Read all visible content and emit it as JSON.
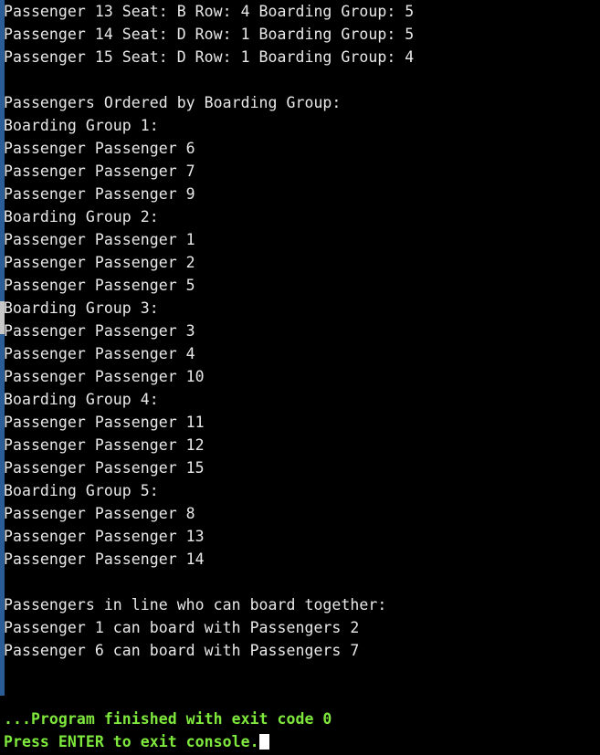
{
  "console": {
    "background_color": "#000000",
    "text_color": "#e9e9e9",
    "exit_text_color": "#7ee83c",
    "scrollbar": {
      "track_color": "#2a5d96",
      "thumb_color": "#c8c8c8"
    },
    "cursor": {
      "shape": "block",
      "color": "#ffffff"
    }
  },
  "lines": [
    {
      "id": 0,
      "text": "Passenger 13 Seat: B Row: 4 Boarding Group: 5",
      "style": "normal"
    },
    {
      "id": 1,
      "text": "Passenger 14 Seat: D Row: 1 Boarding Group: 5",
      "style": "normal"
    },
    {
      "id": 2,
      "text": "Passenger 15 Seat: D Row: 1 Boarding Group: 4",
      "style": "normal"
    },
    {
      "id": 3,
      "text": "",
      "style": "blank"
    },
    {
      "id": 4,
      "text": "Passengers Ordered by Boarding Group:",
      "style": "normal"
    },
    {
      "id": 5,
      "text": "Boarding Group 1:",
      "style": "normal"
    },
    {
      "id": 6,
      "text": "Passenger Passenger 6",
      "style": "normal"
    },
    {
      "id": 7,
      "text": "Passenger Passenger 7",
      "style": "normal"
    },
    {
      "id": 8,
      "text": "Passenger Passenger 9",
      "style": "normal"
    },
    {
      "id": 9,
      "text": "Boarding Group 2:",
      "style": "normal"
    },
    {
      "id": 10,
      "text": "Passenger Passenger 1",
      "style": "normal"
    },
    {
      "id": 11,
      "text": "Passenger Passenger 2",
      "style": "normal"
    },
    {
      "id": 12,
      "text": "Passenger Passenger 5",
      "style": "normal"
    },
    {
      "id": 13,
      "text": "Boarding Group 3:",
      "style": "normal"
    },
    {
      "id": 14,
      "text": "Passenger Passenger 3",
      "style": "normal"
    },
    {
      "id": 15,
      "text": "Passenger Passenger 4",
      "style": "normal"
    },
    {
      "id": 16,
      "text": "Passenger Passenger 10",
      "style": "normal"
    },
    {
      "id": 17,
      "text": "Boarding Group 4:",
      "style": "normal"
    },
    {
      "id": 18,
      "text": "Passenger Passenger 11",
      "style": "normal"
    },
    {
      "id": 19,
      "text": "Passenger Passenger 12",
      "style": "normal"
    },
    {
      "id": 20,
      "text": "Passenger Passenger 15",
      "style": "normal"
    },
    {
      "id": 21,
      "text": "Boarding Group 5:",
      "style": "normal"
    },
    {
      "id": 22,
      "text": "Passenger Passenger 8",
      "style": "normal"
    },
    {
      "id": 23,
      "text": "Passenger Passenger 13",
      "style": "normal"
    },
    {
      "id": 24,
      "text": "Passenger Passenger 14",
      "style": "normal"
    },
    {
      "id": 25,
      "text": "",
      "style": "blank"
    },
    {
      "id": 26,
      "text": "Passengers in line who can board together:",
      "style": "normal"
    },
    {
      "id": 27,
      "text": "Passenger 1 can board with Passengers 2",
      "style": "normal"
    },
    {
      "id": 28,
      "text": "Passenger 6 can board with Passengers 7",
      "style": "normal"
    },
    {
      "id": 29,
      "text": "",
      "style": "blank"
    },
    {
      "id": 30,
      "text": "",
      "style": "blank"
    },
    {
      "id": 31,
      "text": "...Program finished with exit code 0",
      "style": "exit"
    },
    {
      "id": 32,
      "text": "Press ENTER to exit console.",
      "style": "exit",
      "cursor": true
    }
  ]
}
